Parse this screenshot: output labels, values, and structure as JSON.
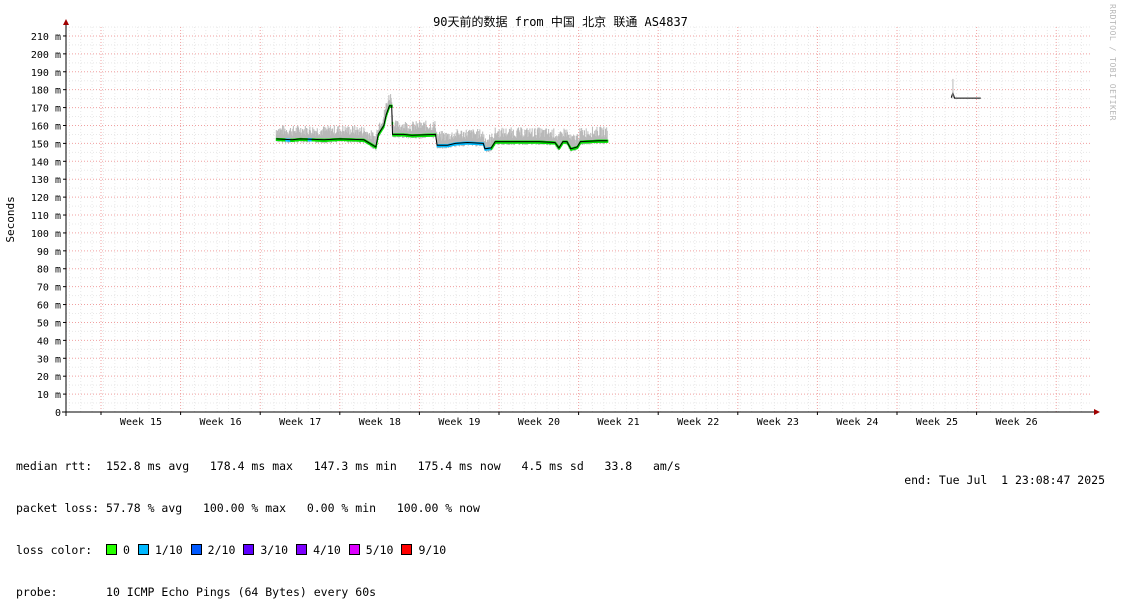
{
  "title": "90天前的数据 from 中国 北京 联通 AS4837",
  "vendor_text": "RRDTOOL / TOBI OETIKER",
  "chart_data": {
    "type": "line",
    "title": "90天前的数据 from 中国 北京 联通 AS4837",
    "ylabel": "Seconds",
    "xlabel": "",
    "ylim": [
      0,
      215
    ],
    "yticks": [
      0,
      10,
      20,
      30,
      40,
      50,
      60,
      70,
      80,
      90,
      100,
      110,
      120,
      130,
      140,
      150,
      160,
      170,
      180,
      190,
      200,
      210
    ],
    "ytick_labels": [
      "0",
      "10 m",
      "20 m",
      "30 m",
      "40 m",
      "50 m",
      "60 m",
      "70 m",
      "80 m",
      "90 m",
      "100 m",
      "110 m",
      "120 m",
      "130 m",
      "140 m",
      "150 m",
      "160 m",
      "170 m",
      "180 m",
      "190 m",
      "200 m",
      "210 m"
    ],
    "xlim_weeks": [
      14.1,
      27.0
    ],
    "xticks": [
      {
        "label": "Week 15",
        "week": 15
      },
      {
        "label": "Week 16",
        "week": 16
      },
      {
        "label": "Week 17",
        "week": 17
      },
      {
        "label": "Week 18",
        "week": 18
      },
      {
        "label": "Week 19",
        "week": 19
      },
      {
        "label": "Week 20",
        "week": 20
      },
      {
        "label": "Week 21",
        "week": 21
      },
      {
        "label": "Week 22",
        "week": 22
      },
      {
        "label": "Week 23",
        "week": 23
      },
      {
        "label": "Week 24",
        "week": 24
      },
      {
        "label": "Week 25",
        "week": 25
      },
      {
        "label": "Week 26",
        "week": 26
      }
    ],
    "grid": true,
    "series": [
      {
        "name": "median rtt",
        "unit": "ms",
        "points": [
          [
            16.7,
            152.5
          ],
          [
            16.9,
            152.0
          ],
          [
            17.0,
            152.5
          ],
          [
            17.3,
            152.0
          ],
          [
            17.5,
            152.5
          ],
          [
            17.8,
            152.0
          ],
          [
            17.95,
            148
          ],
          [
            17.98,
            155
          ],
          [
            18.05,
            160
          ],
          [
            18.08,
            166
          ],
          [
            18.12,
            171
          ],
          [
            18.15,
            171
          ],
          [
            18.16,
            155
          ],
          [
            18.3,
            155
          ],
          [
            18.4,
            154.5
          ],
          [
            18.7,
            155
          ],
          [
            18.72,
            149
          ],
          [
            18.85,
            149
          ],
          [
            18.95,
            150
          ],
          [
            19.1,
            150.5
          ],
          [
            19.3,
            150
          ],
          [
            19.32,
            147
          ],
          [
            19.4,
            147.5
          ],
          [
            19.45,
            151
          ],
          [
            19.7,
            151
          ],
          [
            20.0,
            151
          ],
          [
            20.2,
            150.5
          ],
          [
            20.25,
            147.5
          ],
          [
            20.3,
            151
          ],
          [
            20.35,
            151
          ],
          [
            20.4,
            147
          ],
          [
            20.48,
            148
          ],
          [
            20.52,
            151
          ],
          [
            20.75,
            151.5
          ],
          [
            20.86,
            151.5
          ]
        ]
      },
      {
        "name": "median rtt (later)",
        "unit": "ms",
        "points": [
          [
            25.18,
            175.5
          ],
          [
            25.2,
            178.4
          ],
          [
            25.22,
            175.3
          ],
          [
            25.55,
            175.3
          ]
        ]
      }
    ],
    "loss_bands": [
      {
        "color": "#00e000",
        "label": "0",
        "from_week": 16.7,
        "to_week": 16.82
      },
      {
        "color": "#00bbff",
        "label": "1/10",
        "from_week": 16.82,
        "to_week": 16.88
      },
      {
        "color": "#00e000",
        "label": "0",
        "from_week": 16.88,
        "to_week": 17.1
      },
      {
        "color": "#00bbff",
        "label": "1/10",
        "from_week": 17.1,
        "to_week": 17.15
      },
      {
        "color": "#00e000",
        "label": "0",
        "from_week": 17.15,
        "to_week": 18.7
      },
      {
        "color": "#00bbff",
        "label": "1/10",
        "from_week": 18.72,
        "to_week": 19.4
      },
      {
        "color": "#00e000",
        "label": "0",
        "from_week": 19.4,
        "to_week": 20.86
      }
    ]
  },
  "stats": {
    "median_rtt_label": "median rtt:",
    "median_rtt_values": "152.8 ms avg   178.4 ms max   147.3 ms min   175.4 ms now   4.5 ms sd   33.8   am/s",
    "packet_loss_label": "packet loss:",
    "packet_loss_values": "57.78 % avg   100.00 % max   0.00 % min   100.00 % now",
    "loss_color_label": "loss color:",
    "loss_colors": [
      {
        "color": "#26ff00",
        "label": "0"
      },
      {
        "color": "#00b8ff",
        "label": "1/10"
      },
      {
        "color": "#0059ff",
        "label": "2/10"
      },
      {
        "color": "#5e00ff",
        "label": "3/10"
      },
      {
        "color": "#7e00ff",
        "label": "4/10"
      },
      {
        "color": "#dd00ff",
        "label": "5/10"
      },
      {
        "color": "#ff0000",
        "label": "9/10"
      }
    ],
    "probe_label": "probe:",
    "probe_value": "10 ICMP Echo Pings (64 Bytes) every 60s",
    "end_text": "end: Tue Jul  1 23:08:47 2025"
  }
}
